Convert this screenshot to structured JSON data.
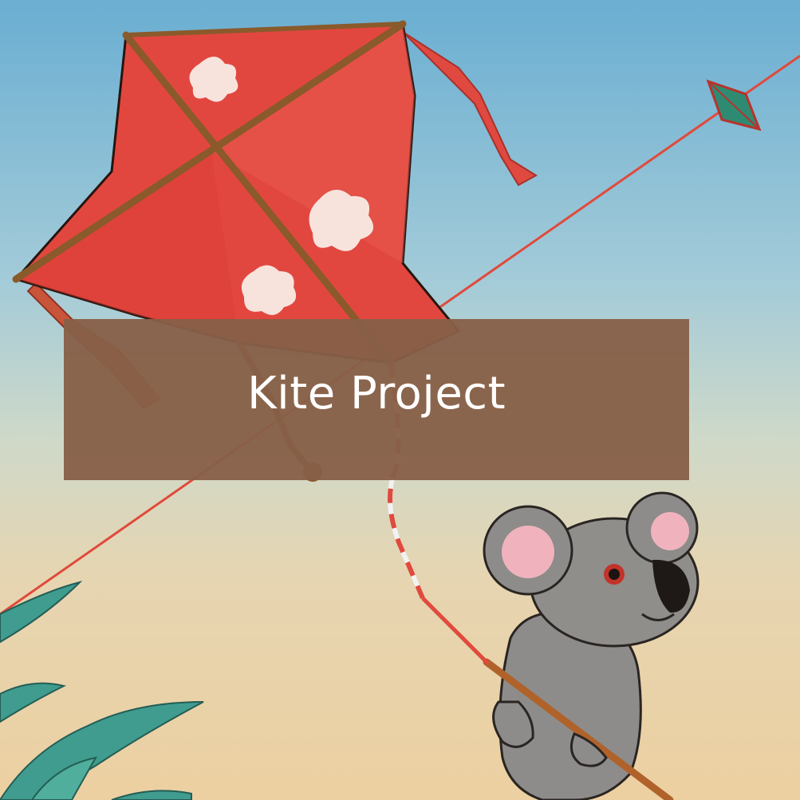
{
  "banner": {
    "title": "Kite Project"
  },
  "illustration": {
    "subjects": [
      "red-kite-icon",
      "small-green-kite-icon",
      "koala-icon",
      "leaves-icon"
    ]
  },
  "colors": {
    "sky_top": "#6fb2d4",
    "sky_mid": "#a9d0d8",
    "sand": "#e9cfa2",
    "kite_red": "#e24b41",
    "kite_frame": "#8a5a2b",
    "banner": "#876048",
    "koala_grey": "#8d8c8a",
    "leaf_teal": "#3f9c8e"
  }
}
